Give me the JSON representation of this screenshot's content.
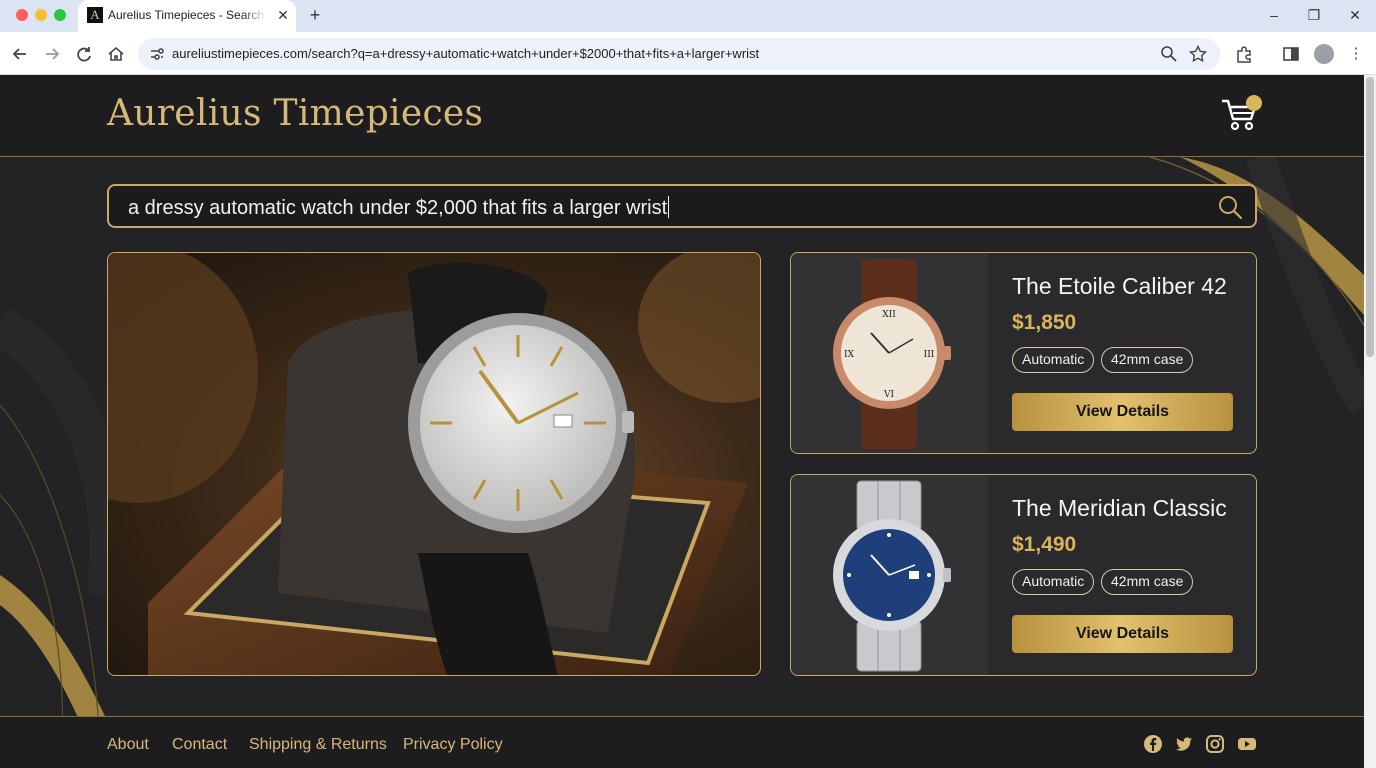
{
  "browser": {
    "tab_title": "Aurelius Timepieces - Search Results",
    "favicon_letter": "A",
    "tab_close": "✕",
    "new_tab": "+",
    "url": "aureliustimepieces.com/search?q=a+dressy+automatic+watch+under+$2000+that+fits+a+larger+wrist",
    "icons": [
      "back-icon",
      "forward-icon",
      "reload-icon",
      "home-icon",
      "site-info-icon",
      "zoom-icon",
      "star-icon",
      "extensions-icon",
      "sidepanel-icon",
      "profile-icon",
      "menu-icon"
    ]
  },
  "site": {
    "logo": "Aurelius Timepieces",
    "accent_color": "#d6b878",
    "button_gold": "#d9b45a"
  },
  "search": {
    "query": "a dressy automatic watch under $2,000 that fits a larger wrist"
  },
  "products": [
    {
      "name": "The Etoile Caliber 42",
      "price": "$1,850",
      "tags": [
        "Automatic",
        "42mm case"
      ],
      "button": "View Details",
      "image": "rose-gold-watch-brown-strap"
    },
    {
      "name": "The Meridian Classic",
      "price": "$1,490",
      "tags": [
        "Automatic",
        "42mm case"
      ],
      "button": "View Details",
      "image": "steel-watch-blue-dial-bracelet"
    }
  ],
  "hero": {
    "image": "silver-dial-watch-black-strap-on-display-cushion"
  },
  "footer": {
    "links": [
      "About",
      "Contact",
      "Shipping & Returns",
      "Privacy Policy"
    ],
    "social": [
      "facebook-icon",
      "twitter-icon",
      "instagram-icon",
      "youtube-icon"
    ]
  }
}
